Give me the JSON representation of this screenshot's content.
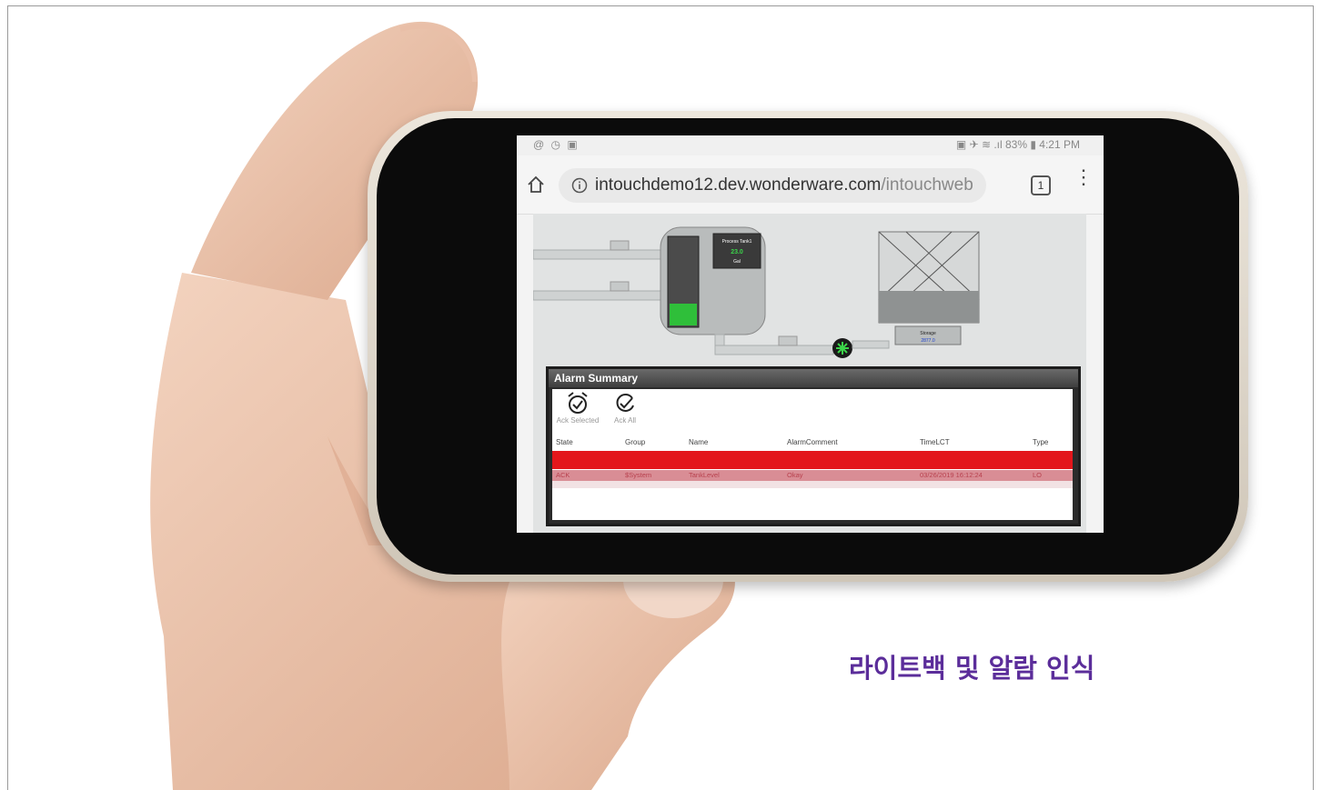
{
  "statusbar": {
    "left_icons": "@ ◷ ▣",
    "right_text": "▣ ✈ ≋ .ıl 83% ▮ 4:21 PM"
  },
  "browser": {
    "url_host": "intouchdemo12.dev.wonderware.com",
    "url_path": "/intouchweb",
    "tab_count": "1",
    "icons": [
      "home-icon",
      "info-icon",
      "tabs-icon",
      "menu-icon"
    ]
  },
  "hmi": {
    "tank_label": "Process Tank1",
    "tank_value": "23.0",
    "tank_unit": "Gal",
    "tank_level_fraction": 0.25,
    "storage_label": "Storage",
    "storage_value": "2877.0"
  },
  "alarm": {
    "title": "Alarm Summary",
    "ack_selected_label": "Ack Selected",
    "ack_all_label": "Ack All",
    "columns": [
      "State",
      "Group",
      "Name",
      "AlarmComment",
      "TimeLCT",
      "Type"
    ],
    "row": {
      "state": "ACK",
      "group": "$System",
      "name": "TankLevel",
      "comment": "Okay",
      "time": "03/26/2019 16:12:24",
      "type": "LO"
    }
  },
  "caption": "라이트백 및 알람 인식",
  "colors": {
    "caption": "#5b2d9a",
    "alarm_red": "#e3161b",
    "ack_row": "#d98d95",
    "tank_fill": "#2fbf3a"
  }
}
